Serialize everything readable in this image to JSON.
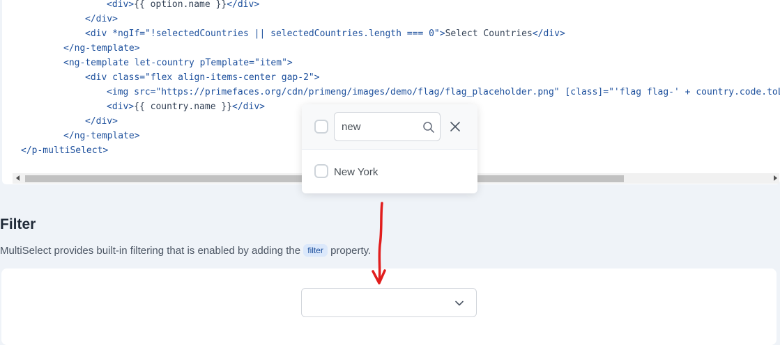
{
  "code": {
    "lines": [
      [
        {
          "t": "<div>",
          "c": "tag"
        },
        {
          "t": "{{ option.name }}",
          "c": "txt"
        },
        {
          "t": "</div>",
          "c": "tag"
        }
      ],
      [
        {
          "t": "</div>",
          "c": "tag"
        }
      ],
      [
        {
          "t": "<div ",
          "c": "tag"
        },
        {
          "t": "*ngIf=",
          "c": "attr"
        },
        {
          "t": "\"!selectedCountries || selectedCountries.length === 0\"",
          "c": "str"
        },
        {
          "t": ">",
          "c": "tag"
        },
        {
          "t": "Select Countries",
          "c": "txt"
        },
        {
          "t": "</div>",
          "c": "tag"
        }
      ],
      [
        {
          "t": "</ng-template>",
          "c": "tag"
        }
      ],
      [
        {
          "t": "<ng-template ",
          "c": "tag"
        },
        {
          "t": "let-country pTemplate=",
          "c": "attr"
        },
        {
          "t": "\"item\"",
          "c": "str"
        },
        {
          "t": ">",
          "c": "tag"
        }
      ],
      [
        {
          "t": "<div ",
          "c": "tag"
        },
        {
          "t": "class=",
          "c": "attr"
        },
        {
          "t": "\"flex align-items-center gap-2\"",
          "c": "str"
        },
        {
          "t": ">",
          "c": "tag"
        }
      ],
      [
        {
          "t": "<img ",
          "c": "tag"
        },
        {
          "t": "src=",
          "c": "attr"
        },
        {
          "t": "\"https://primefaces.org/cdn/primeng/images/demo/flag/flag_placeholder.png\"",
          "c": "str"
        },
        {
          "t": " [class]=",
          "c": "attr"
        },
        {
          "t": "\"'flag flag-' + country.code.toLo",
          "c": "str"
        }
      ],
      [
        {
          "t": "<div>",
          "c": "tag"
        },
        {
          "t": "{{ country.name }}",
          "c": "txt"
        },
        {
          "t": "</div>",
          "c": "tag"
        }
      ],
      [
        {
          "t": "</div>",
          "c": "tag"
        }
      ],
      [
        {
          "t": "</ng-template>",
          "c": "tag"
        }
      ],
      [
        {
          "t": "</p-multiSelect>",
          "c": "tag"
        }
      ]
    ]
  },
  "overlay": {
    "search_value": "new",
    "options": [
      {
        "label": "New York",
        "checked": false
      }
    ]
  },
  "filter_section": {
    "title": "Filter",
    "desc_before": "MultiSelect provides built-in filtering that is enabled by adding the ",
    "chip": "filter",
    "desc_after": " property."
  },
  "multiselect": {
    "value": ""
  },
  "icons": {
    "search": "search-icon",
    "close": "close-icon",
    "chevron": "chevron-down-icon",
    "arrow": "red-arrow-annotation"
  },
  "colors": {
    "code": "#1c4f9c",
    "annotation": "#e11d1d",
    "chip_bg": "#dbe8fb"
  }
}
